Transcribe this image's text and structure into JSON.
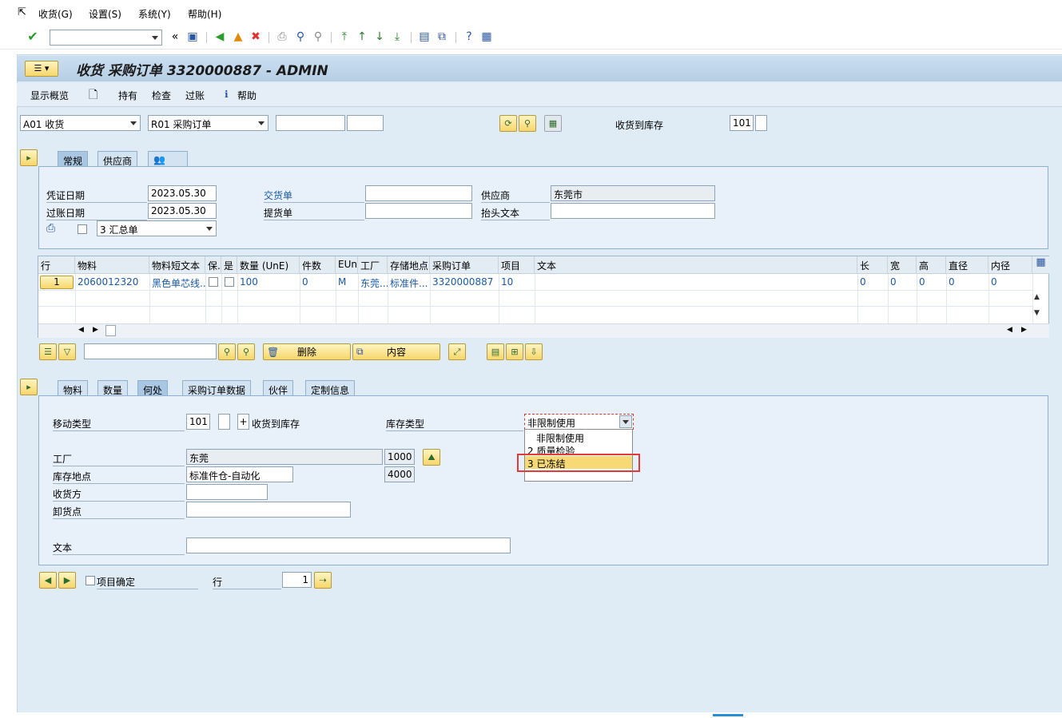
{
  "menu": {
    "items": [
      "收货(G)",
      "设置(S)",
      "系统(Y)",
      "帮助(H)"
    ]
  },
  "toolbar": {
    "command_field": "",
    "icons": [
      "enter-check-icon",
      "save-icon",
      "back-icon",
      "exit-icon",
      "cancel-icon",
      "print-icon",
      "find-icon",
      "find-next-icon",
      "first-page-icon",
      "prev-page-icon",
      "next-page-icon",
      "last-page-icon",
      "new-session-icon",
      "shortcut-icon",
      "help-icon",
      "customize-icon"
    ]
  },
  "title": "收货 采购订单 3320000887 - ADMIN",
  "appbar": {
    "overview": "显示概览",
    "hold": "持有",
    "check": "检查",
    "post": "过账",
    "help": "帮助"
  },
  "header_row": {
    "action": "A01 收货",
    "ref_doc": "R01 采购订单",
    "field1": "",
    "field2": "",
    "movement_label": "收货到库存",
    "movement_type": "101"
  },
  "top_tabs": [
    "常规",
    "供应商"
  ],
  "general": {
    "doc_date_label": "凭证日期",
    "doc_date": "2023.05.30",
    "post_date_label": "过账日期",
    "post_date": "2023.05.30",
    "delivery_note_label": "交货单",
    "delivery_note": "",
    "bill_of_lading_label": "提货单",
    "bill_of_lading": "",
    "vendor_label": "供应商",
    "vendor": "东莞市",
    "header_text_label": "抬头文本",
    "header_text": "",
    "print_option": "3 汇总单"
  },
  "table": {
    "headers": [
      "行",
      "物料",
      "物料短文本",
      "保.",
      "是",
      "数量 (UnE)",
      "件数",
      "EUn",
      "工厂",
      "存储地点",
      "采购订单",
      "项目",
      "文本",
      "长",
      "宽",
      "高",
      "直径",
      "内径"
    ],
    "row": {
      "line": "1",
      "material": "2060012320",
      "short_text": "黑色单芯线...",
      "qty": "100",
      "pieces": "0",
      "eun": "M",
      "plant": "东莞...",
      "sloc": "标准件...",
      "po": "3320000887",
      "item": "10",
      "text": "",
      "len": "0",
      "wid": "0",
      "hgt": "0",
      "dia": "0",
      "idia": "0"
    }
  },
  "grid_toolbar": {
    "search": "",
    "delete": "删除",
    "content": "内容"
  },
  "detail_tabs": [
    "物料",
    "数量",
    "何处",
    "采购订单数据",
    "伙伴",
    "定制信息"
  ],
  "where": {
    "movement_type_label": "移动类型",
    "movement_type": "101",
    "plus": "+",
    "movement_desc": "收货到库存",
    "stock_type_label": "库存类型",
    "stock_type": "非限制使用",
    "plant_label": "工厂",
    "plant_name": "东莞",
    "plant_code": "1000",
    "sloc_label": "库存地点",
    "sloc_name": "标准件仓-自动化",
    "sloc_code": "4000",
    "recipient_label": "收货方",
    "recipient": "",
    "unloading_label": "卸货点",
    "unloading": "",
    "text_label": "文本",
    "text": ""
  },
  "stock_type_options": [
    "非限制使用",
    "2 质量检验",
    "3 已冻结"
  ],
  "footer": {
    "item_ok": "项目确定",
    "line_label": "行",
    "line_value": "1"
  }
}
